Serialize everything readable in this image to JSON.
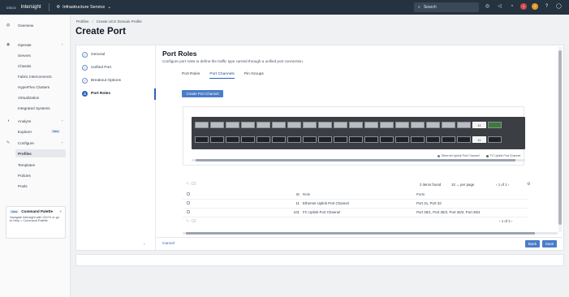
{
  "topbar": {
    "logo": "cisco",
    "brand": "Intersight",
    "service": "Infrastructure Service",
    "search_placeholder": "Search",
    "badge_red": "1",
    "badge_orange": "1",
    "icons": [
      "search-icon",
      "check-circle-icon",
      "megaphone-icon",
      "bell-icon",
      "help-icon",
      "user-icon"
    ]
  },
  "sidebar": {
    "items": [
      {
        "label": "Overview",
        "icon": "home-icon"
      },
      {
        "label": "Operate",
        "icon": "operate-icon"
      },
      {
        "label": "Servers"
      },
      {
        "label": "Chassis"
      },
      {
        "label": "Fabric Interconnects"
      },
      {
        "label": "HyperFlex Clusters"
      },
      {
        "label": "Virtualization"
      },
      {
        "label": "Integrated Systems"
      },
      {
        "label": "Analyze",
        "icon": "analyze-icon"
      },
      {
        "label": "Explorer",
        "tag": "New"
      },
      {
        "label": "Configure",
        "icon": "configure-icon"
      },
      {
        "label": "Profiles"
      },
      {
        "label": "Templates"
      },
      {
        "label": "Policies"
      },
      {
        "label": "Pools"
      }
    ],
    "palette": {
      "tag": "New",
      "title": "Command Palette",
      "body_line1": "Navigate Intersight with Ctrl+K or go",
      "body_line2": "to Help > Command Palette"
    }
  },
  "breadcrumb": {
    "items": [
      "Profiles",
      "Create UCS Domain Profile"
    ]
  },
  "page_title": "Create Port",
  "steps": [
    {
      "label": "General",
      "state": "done"
    },
    {
      "label": "Unified Port",
      "state": "done"
    },
    {
      "label": "Breakout Options",
      "state": "done"
    },
    {
      "label": "Port Roles",
      "state": "current",
      "number": "4"
    }
  ],
  "section": {
    "title": "Port Roles",
    "description": "Configure port roles to define the traffic type carried through a unified port connection."
  },
  "tabs": [
    {
      "label": "Port Roles",
      "active": false
    },
    {
      "label": "Port Channels",
      "active": true
    },
    {
      "label": "Pin Groups",
      "active": false
    }
  ],
  "create_button": "Create Port Channel",
  "switch": {
    "highlight_label": "11",
    "legend": [
      {
        "label": "Ethernet Uplink Port Channel",
        "color": "#7a7f86"
      },
      {
        "label": "FC Uplink Port Channel",
        "color": "#3c7a3c"
      }
    ]
  },
  "table": {
    "count": "2 items found",
    "per_page_value": "10",
    "per_page_label": "per page",
    "page_current": "1",
    "page_of": "of 1",
    "columns": [
      "ID",
      "Role",
      "Ports"
    ],
    "rows": [
      {
        "id": "11",
        "role": "Ethernet Uplink Port Channel",
        "ports": "Port 31, Port 32"
      },
      {
        "id": "101",
        "role": "FC Uplink Port Channel",
        "ports": "Port 35/1, Port 35/2, Port 35/3, Port 35/4"
      }
    ],
    "footer_page_current": "1",
    "footer_page_of": "of 1"
  },
  "footer": {
    "cancel": "Cancel",
    "back": "Back",
    "save": "Save"
  }
}
